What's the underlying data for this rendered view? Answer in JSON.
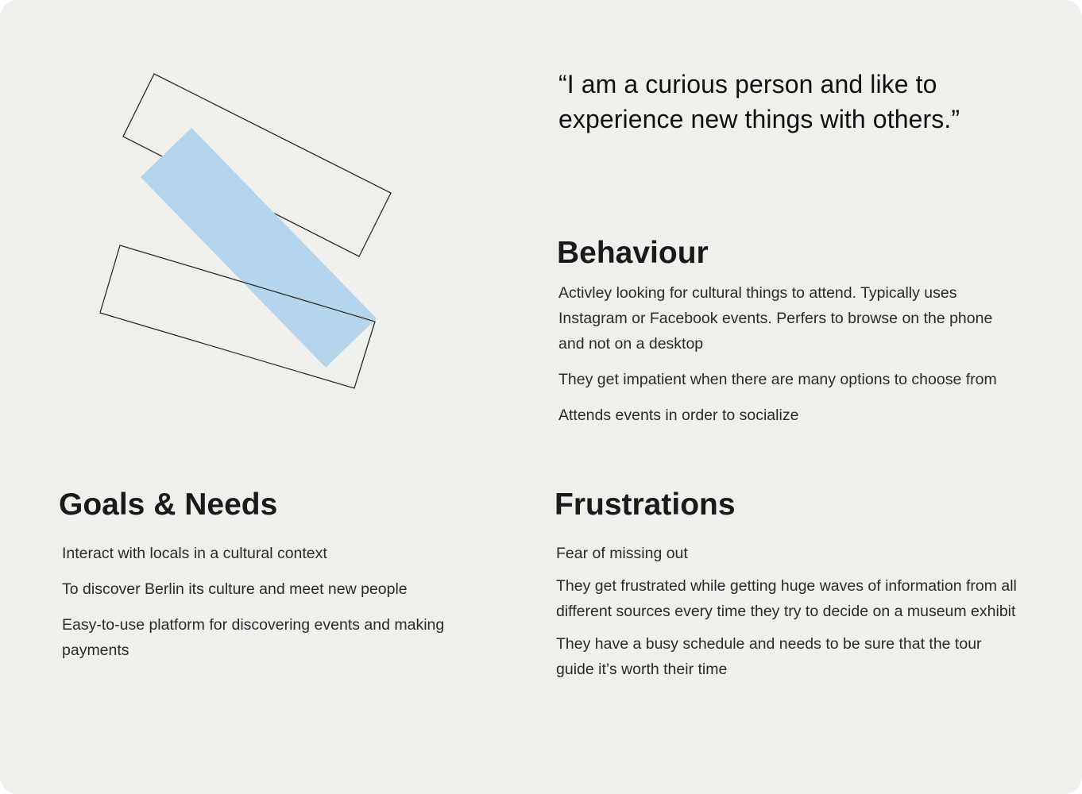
{
  "persona": {
    "quote_line_1": "“I am a curious person and like to",
    "quote_line_2": "experience new things with others.”"
  },
  "behaviour": {
    "title": "Behaviour",
    "items": [
      "Activley looking for cultural things to attend. Typically uses Instagram or Facebook events. Perfers to browse on the phone and not on a desktop",
      "They get impatient when there are many options to choose from",
      "Attends events in order to socialize"
    ]
  },
  "goals": {
    "title": "Goals & Needs",
    "items": [
      "Interact with locals in a cultural context",
      "To discover Berlin its culture and meet new people",
      "Easy-to-use platform for discovering events and making payments"
    ]
  },
  "frustrations": {
    "title": "Frustrations",
    "items": [
      "Fear of missing out",
      "They get frustrated while getting huge waves of information from all different sources every time they try to decide on a museum exhibit",
      "They have a busy schedule and needs to be sure that the tour guide it’s worth their time"
    ]
  },
  "colors": {
    "background": "#f1efeb",
    "accent_blue": "#b5d5ec",
    "outline": "#2b2b2b",
    "text": "#1c1c1c"
  }
}
